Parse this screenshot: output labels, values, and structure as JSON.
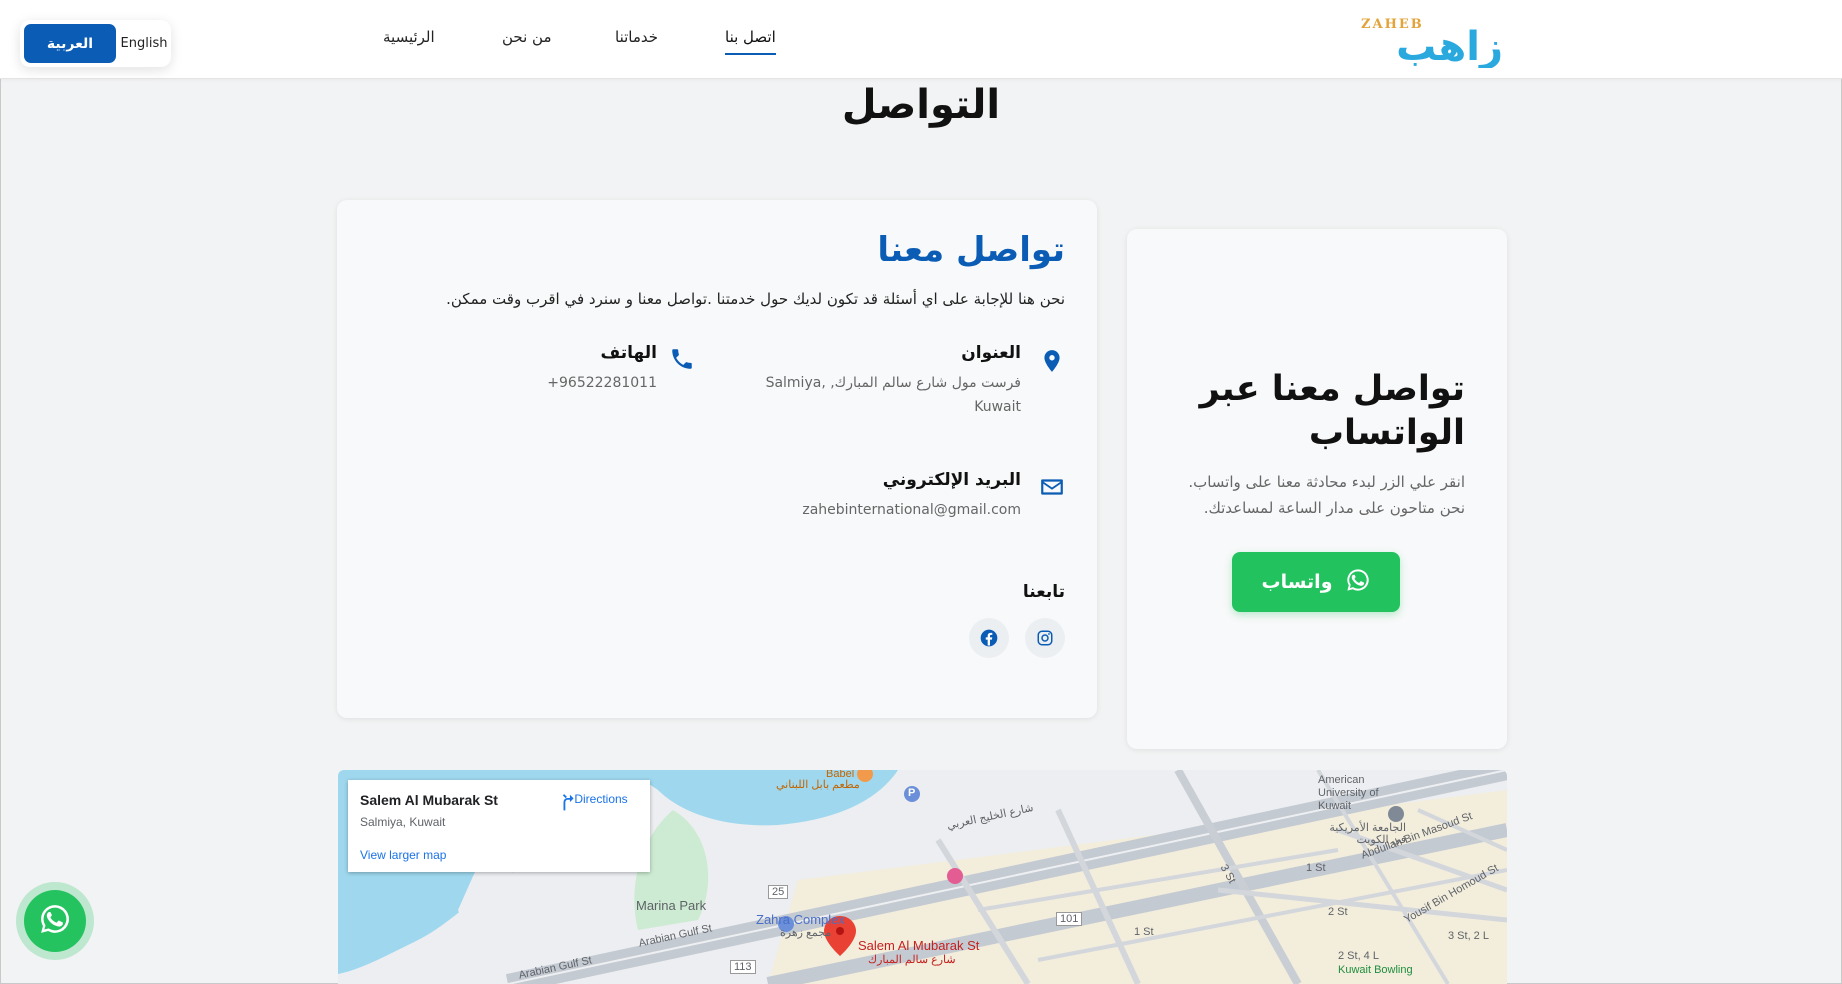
{
  "header": {
    "lang_ar": "العربية",
    "lang_en": "English",
    "nav": {
      "home": "الرئيسية",
      "about": "من نحن",
      "services": "خدماتنا",
      "contact": "اتصل بنا"
    },
    "logo_text_ar": "زاهب",
    "logo_text_en": "ZAHEB"
  },
  "page_title": "التواصل",
  "contact": {
    "title": "تواصل معنا",
    "description": "نحن هنا للإجابة على اي أسئلة قد تكون لديك حول خدمتنا .تواصل معنا و سنرد في اقرب وقت ممكن.",
    "address_title": "العنوان",
    "address_line1": "فرست مول شارع سالم المبارك, ,Salmiya",
    "address_line2": "Kuwait",
    "phone_title": "الهاتف",
    "phone_value": "+96522281011",
    "email_title": "البريد الإلكتروني",
    "email_value": "zahebinternational@gmail.com",
    "follow_title": "تابعنا"
  },
  "whatsapp_card": {
    "title": "تواصل معنا عبر الواتساب",
    "desc_line1": "انقر علي الزر لبدء محادثة معنا على واتساب.",
    "desc_line2": "نحن متاحون على مدار الساعة لمساعدتك.",
    "button_label": "واتساب"
  },
  "map": {
    "popup_title": "Salem Al Mubarak St",
    "popup_subtitle": "Salmiya, Kuwait",
    "popup_link": "View larger map",
    "directions": "Directions",
    "labels": {
      "marina_park": "Marina Park",
      "zahra_complex": "Zahra Complex",
      "zahra_complex_ar": "مجمع زهرة",
      "salem_st": "Salem Al Mubarak St",
      "salem_st_ar": "شارع سالم المبارك",
      "arabian_gulf_st": "Arabian Gulf St",
      "arabian_gulf_st2": "Arabian Gulf St",
      "gulf_st_ar": "شارع الخليج العربي",
      "auk": "American University of Kuwait",
      "auk_ar": "الجامعة الأمريكية في الكويت",
      "abdullah_st": "Abdullah Bin Masoud St",
      "yousif_st": "Yousif Bin Homoud St",
      "bowling": "Kuwait Bowling",
      "babel": "Babel",
      "babel_ar": "مطعم بابل اللبناني",
      "st1": "1 St",
      "st1b": "1 St",
      "st2": "2 St",
      "st3": "3 St",
      "st3b": "3 St, 2 L",
      "st2b": "2 St, 4 L",
      "road25": "25",
      "road101": "101",
      "road113": "113",
      "parking": "P"
    }
  },
  "colors": {
    "primary": "#0b5cb5",
    "whatsapp": "#22c35e",
    "background": "#f2f3f4"
  }
}
